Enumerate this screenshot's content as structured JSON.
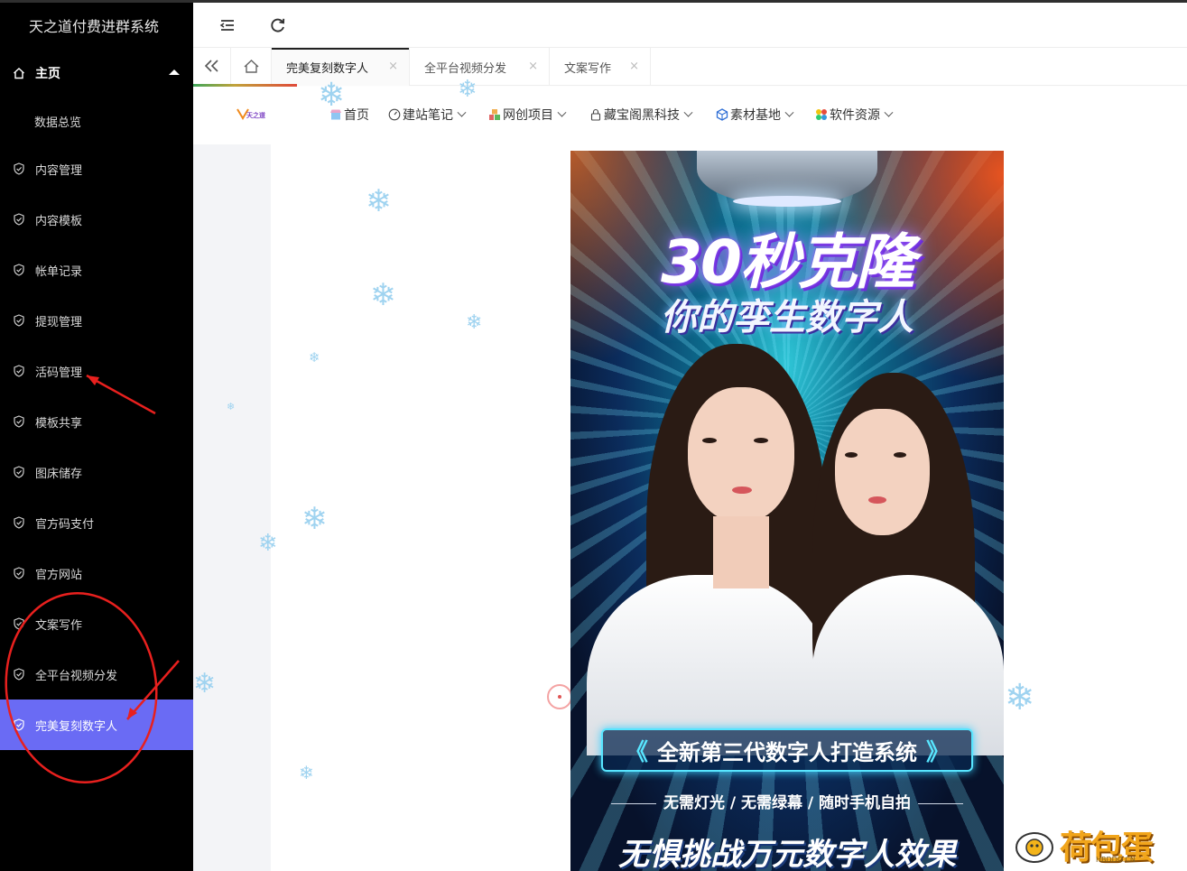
{
  "app": {
    "title": "天之道付费进群系统"
  },
  "sidebar": {
    "items": [
      {
        "label": "主页",
        "icon": "home-icon"
      },
      {
        "label": "数据总览"
      },
      {
        "label": "内容管理",
        "icon": "shield-check-icon"
      },
      {
        "label": "内容模板",
        "icon": "shield-check-icon"
      },
      {
        "label": "帐单记录",
        "icon": "shield-check-icon"
      },
      {
        "label": "提现管理",
        "icon": "shield-check-icon"
      },
      {
        "label": "活码管理",
        "icon": "shield-check-icon"
      },
      {
        "label": "模板共享",
        "icon": "shield-check-icon"
      },
      {
        "label": "图床储存",
        "icon": "shield-check-icon"
      },
      {
        "label": "官方码支付",
        "icon": "shield-check-icon"
      },
      {
        "label": "官方网站",
        "icon": "shield-check-icon"
      },
      {
        "label": "文案写作",
        "icon": "shield-check-icon"
      },
      {
        "label": "全平台视频分发",
        "icon": "shield-check-icon"
      },
      {
        "label": "完美复刻数字人",
        "icon": "shield-check-icon",
        "active": true
      }
    ]
  },
  "tabs": [
    {
      "label": "完美复刻数字人",
      "active": true
    },
    {
      "label": "全平台视频分发"
    },
    {
      "label": "文案写作"
    }
  ],
  "tab_close": "×",
  "site_nav": {
    "logo_text": "天之道",
    "items": [
      {
        "label": "首页",
        "has_menu": false
      },
      {
        "label": "建站笔记",
        "has_menu": true
      },
      {
        "label": "网创项目",
        "has_menu": true
      },
      {
        "label": "藏宝阁黑科技",
        "has_menu": true
      },
      {
        "label": "素材基地",
        "has_menu": true
      },
      {
        "label": "软件资源",
        "has_menu": true
      }
    ]
  },
  "poster": {
    "title": "30秒克隆",
    "subtitle": "你的孪生数字人",
    "banner": "全新第三代数字人打造系统",
    "banner_left": "《",
    "banner_right": "》",
    "features": "无需灯光 / 无需绿幕 / 随时手机自拍",
    "bottom": "无惧挑战万元数字人效果"
  },
  "snowflake": "❄",
  "watermark": {
    "text": "荷包蛋",
    "sub": "HBDDO.CN"
  },
  "colors": {
    "sidebar_bg": "#000000",
    "active_item": "#6a6bf4",
    "annotation_red": "#e8201e"
  }
}
